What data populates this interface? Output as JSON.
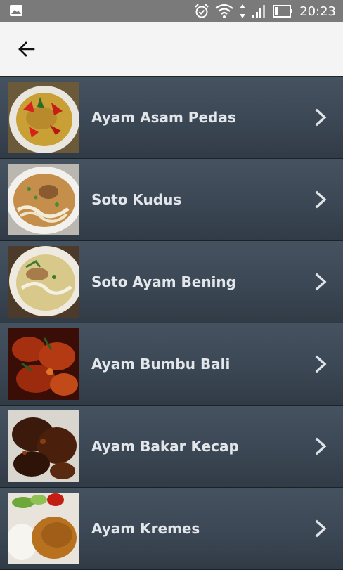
{
  "status_bar": {
    "time": "20:23",
    "icons": [
      "image-icon",
      "alarm-icon",
      "wifi-icon",
      "data-arrows-icon",
      "signal-icon",
      "battery-icon"
    ]
  },
  "app_bar": {
    "back_icon": "arrow-left-icon"
  },
  "menu": {
    "items": [
      {
        "label": "Ayam Asam Pedas",
        "image": "ayam-asam-pedas-photo"
      },
      {
        "label": "Soto Kudus",
        "image": "soto-kudus-photo"
      },
      {
        "label": "Soto Ayam Bening",
        "image": "soto-ayam-bening-photo"
      },
      {
        "label": "Ayam Bumbu Bali",
        "image": "ayam-bumbu-bali-photo"
      },
      {
        "label": "Ayam Bakar Kecap",
        "image": "ayam-bakar-kecap-photo"
      },
      {
        "label": "Ayam Kremes",
        "image": "ayam-kremes-photo"
      }
    ]
  },
  "colors": {
    "status_bar": "#7a7a7a",
    "app_bar": "#f4f4f4",
    "list_background": "#3c4856",
    "label_text": "#e2e6ea"
  }
}
